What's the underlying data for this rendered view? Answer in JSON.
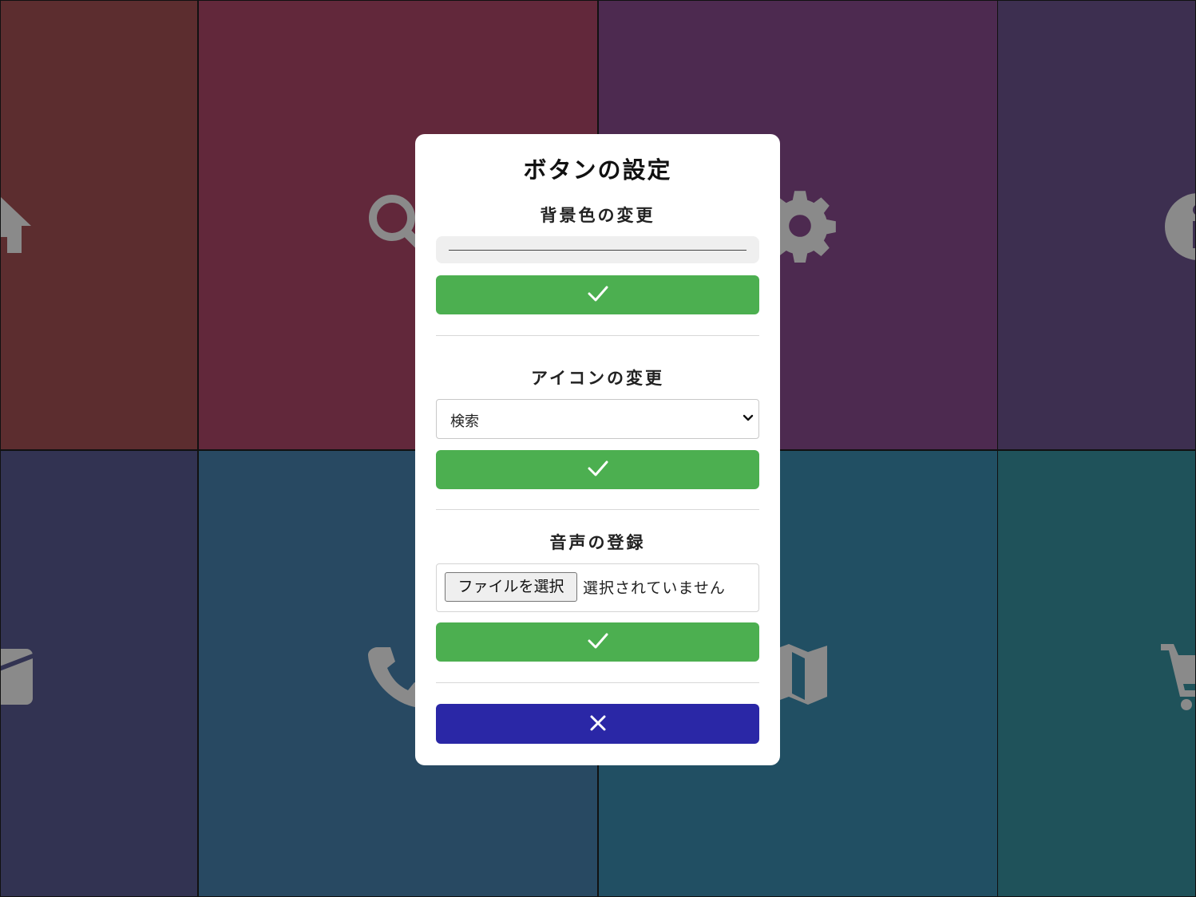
{
  "background_tiles": [
    {
      "name": "home",
      "color": "#5c2d2f",
      "icon": "home-icon"
    },
    {
      "name": "search",
      "color": "#62283b",
      "icon": "search-icon"
    },
    {
      "name": "settings",
      "color": "#4d2a50",
      "icon": "gear-icon"
    },
    {
      "name": "info",
      "color": "#3d2f50",
      "icon": "info-icon"
    },
    {
      "name": "mail",
      "color": "#323352",
      "icon": "mail-icon"
    },
    {
      "name": "phone",
      "color": "#284962",
      "icon": "phone-icon"
    },
    {
      "name": "map",
      "color": "#214f63",
      "icon": "map-icon"
    },
    {
      "name": "cart",
      "color": "#1f525a",
      "icon": "cart-icon"
    }
  ],
  "modal": {
    "title": "ボタンの設定",
    "background_section": {
      "title": "背景色の変更",
      "confirm_icon": "check-icon"
    },
    "icon_section": {
      "title": "アイコンの変更",
      "selected_option": "検索",
      "confirm_icon": "check-icon"
    },
    "audio_section": {
      "title": "音声の登録",
      "file_button_label": "ファイルを選択",
      "file_status": "選択されていません",
      "confirm_icon": "check-icon"
    },
    "close_icon": "close-icon"
  },
  "colors": {
    "confirm": "#4caf50",
    "close": "#2a27a6",
    "icon_fill": "#8a8a8a"
  }
}
